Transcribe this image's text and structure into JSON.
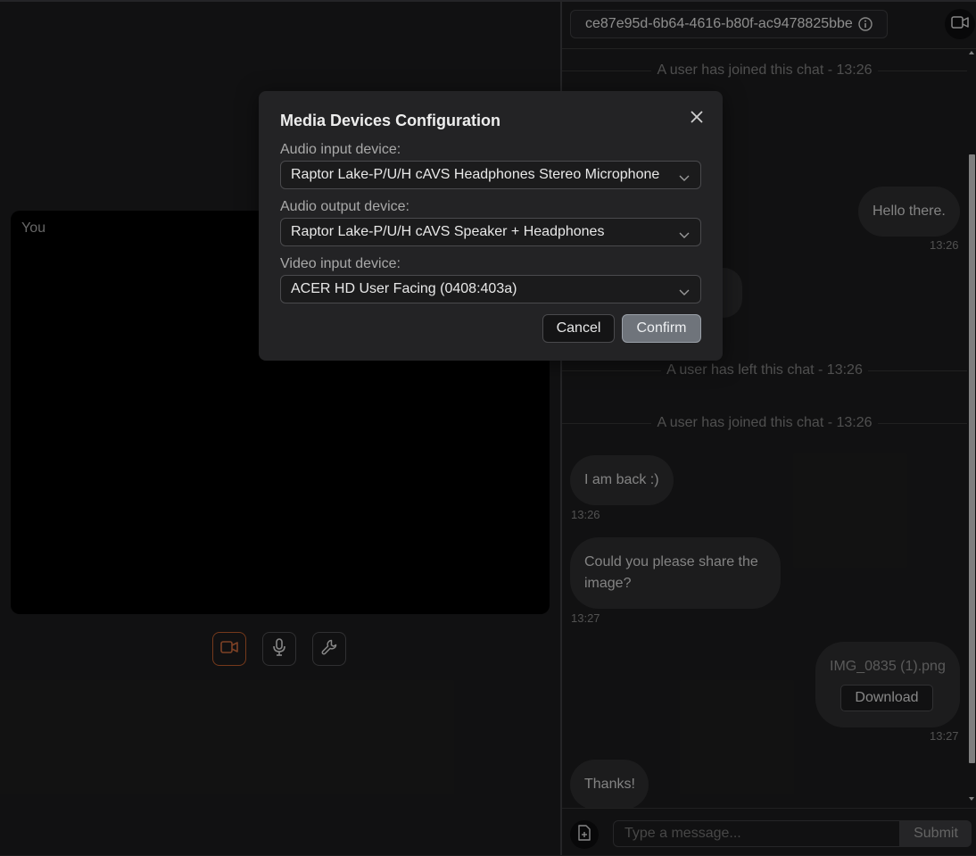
{
  "local_video": {
    "label": "You"
  },
  "room": {
    "id": "ce87e95d-6b64-4616-b80f-ac9478825bbe"
  },
  "messages": [
    {
      "type": "system",
      "text": "A user has joined this chat - 13:26"
    },
    {
      "type": "outgoing",
      "text": "Hello there.",
      "time": "13:26"
    },
    {
      "type": "incoming",
      "text": "",
      "time": ""
    },
    {
      "type": "system",
      "text": "A user has left this chat - 13:26"
    },
    {
      "type": "system",
      "text": "A user has joined this chat - 13:26"
    },
    {
      "type": "incoming",
      "text": "I am back :)",
      "time": "13:26"
    },
    {
      "type": "incoming",
      "text": "Could you please share the image?",
      "time": "13:27"
    },
    {
      "type": "outgoing-file",
      "filename": "IMG_0835 (1).png",
      "button": "Download",
      "time": "13:27"
    },
    {
      "type": "incoming",
      "text": "Thanks!",
      "time": ""
    }
  ],
  "composer": {
    "placeholder": "Type a message...",
    "submit_label": "Submit"
  },
  "modal": {
    "title": "Media Devices Configuration",
    "audio_input_label": "Audio input device:",
    "audio_input_value": "Raptor Lake-P/U/H cAVS Headphones Stereo Microphone",
    "audio_output_label": "Audio output device:",
    "audio_output_value": "Raptor Lake-P/U/H cAVS Speaker + Headphones",
    "video_input_label": "Video input device:",
    "video_input_value": "ACER HD User Facing (0408:403a)",
    "cancel_label": "Cancel",
    "confirm_label": "Confirm"
  },
  "icons": [
    "video-camera-icon",
    "microphone-icon",
    "wrench-icon",
    "info-icon",
    "attach-file-icon",
    "close-icon",
    "chevron-down-icon"
  ],
  "colors": {
    "active_border": "#b4582a",
    "bubble": "#2b2b2d",
    "confirm_button": "#6f747b"
  }
}
